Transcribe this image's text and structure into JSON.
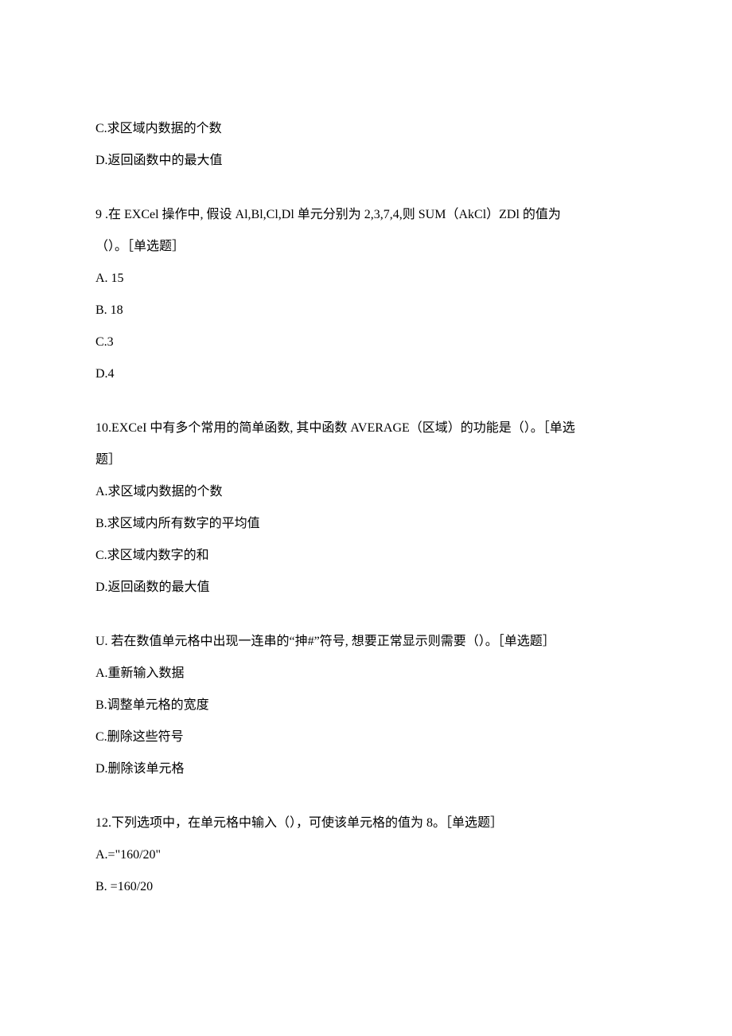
{
  "lines": {
    "l0": "C.求区域内数据的个数",
    "l1": "D.返回函数中的最大值",
    "q9_stem1": "9   .在 EXCel 操作中, 假设 Al,Bl,Cl,Dl 单元分别为 2,3,7,4,则 SUM（AkCl）ZDl 的值为",
    "q9_stem2": "（）。［单选题］",
    "q9_a": "A.   15",
    "q9_b": "B.   18",
    "q9_c": "C.3",
    "q9_d": "D.4",
    "q10_stem1": "10.EXCeI 中有多个常用的简单函数, 其中函数 AVERAGE（区域）的功能是（）。［单选",
    "q10_stem2": "题］",
    "q10_a": "A.求区域内数据的个数",
    "q10_b": "B.求区域内所有数字的平均值",
    "q10_c": "C.求区域内数字的和",
    "q10_d": "D.返回函数的最大值",
    "q11_stem": "U. 若在数值单元格中出现一连串的“抻#”符号, 想要正常显示则需要（）。［单选题］",
    "q11_a": "A.重新输入数据",
    "q11_b": "B.调整单元格的宽度",
    "q11_c": "C.删除这些符号",
    "q11_d": "D.删除该单元格",
    "q12_stem": "12.下列选项中，在单元格中输入（），可使该单元格的值为 8。［单选题］",
    "q12_a": "A.=\"160/20\"",
    "q12_b": "B.   =160/20"
  }
}
